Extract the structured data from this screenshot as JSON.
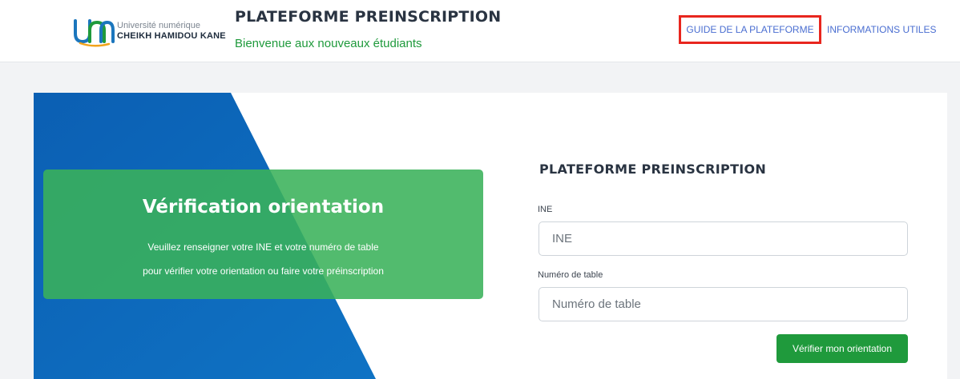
{
  "header": {
    "logo": {
      "line1": "Université numérique",
      "line2": "CHEIKH HAMIDOU KANE",
      "colors": [
        "#1b76bd",
        "#1f9a3c",
        "#f2a31b"
      ]
    },
    "title": "PLATEFORME PREINSCRIPTION",
    "subtitle": "Bienvenue aux nouveaux étudiants",
    "nav": {
      "guide": "GUIDE DE LA PLATEFORME",
      "info": "INFORMATIONS UTILES"
    }
  },
  "hero": {
    "title": "Vérification orientation",
    "line1": "Veuillez renseigner votre INE et votre numéro de table",
    "line2": "pour vérifier votre orientation ou faire votre préinscription"
  },
  "form": {
    "title": "PLATEFORME PREINSCRIPTION",
    "ine_label": "INE",
    "ine_placeholder": "INE",
    "table_label": "Numéro de table",
    "table_placeholder": "Numéro de table",
    "submit_label": "Vérifier mon orientation"
  },
  "colors": {
    "primary_blue": "#0c68b8",
    "green": "#1f9a3c",
    "highlight_red": "#e8261e",
    "link_blue": "#4a6ed1"
  }
}
